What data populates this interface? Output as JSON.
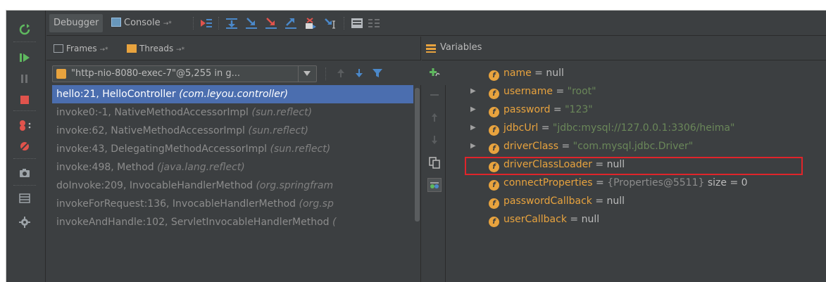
{
  "tabs": {
    "debugger": "Debugger",
    "console": "Console",
    "console_pin": "→*"
  },
  "panes": {
    "frames_tab": "Frames",
    "threads_tab": "Threads",
    "pin": "→*",
    "variables_title": "Variables"
  },
  "thread_selector": {
    "value": "\"http-nio-8080-exec-7\"@5,255 in g..."
  },
  "frames": [
    {
      "method": "hello:21, HelloController",
      "pkg": "(com.leyou.controller)"
    },
    {
      "method": "invoke0:-1, NativeMethodAccessorImpl",
      "pkg": "(sun.reflect)"
    },
    {
      "method": "invoke:62, NativeMethodAccessorImpl",
      "pkg": "(sun.reflect)"
    },
    {
      "method": "invoke:43, DelegatingMethodAccessorImpl",
      "pkg": "(sun.reflect)"
    },
    {
      "method": "invoke:498, Method",
      "pkg": "(java.lang.reflect)"
    },
    {
      "method": "doInvoke:209, InvocableHandlerMethod",
      "pkg": "(org.springfram"
    },
    {
      "method": "invokeForRequest:136, InvocableHandlerMethod",
      "pkg": "(org.sp"
    },
    {
      "method": "invokeAndHandle:102, ServletInvocableHandlerMethod",
      "pkg": "("
    }
  ],
  "variables": [
    {
      "name": "name",
      "eq": " = ",
      "value": "null",
      "value_kind": "null",
      "expandable": false
    },
    {
      "name": "username",
      "eq": " = ",
      "value": "\"root\"",
      "value_kind": "string",
      "expandable": true
    },
    {
      "name": "password",
      "eq": " = ",
      "value": "\"123\"",
      "value_kind": "string",
      "expandable": true
    },
    {
      "name": "jdbcUrl",
      "eq": " = ",
      "value": "\"jdbc:mysql://127.0.0.1:3306/heima\"",
      "value_kind": "string",
      "expandable": true,
      "highlighted": true
    },
    {
      "name": "driverClass",
      "eq": " = ",
      "value": "\"com.mysql.jdbc.Driver\"",
      "value_kind": "string",
      "expandable": true
    },
    {
      "name": "driverClassLoader",
      "eq": " = ",
      "value": "null",
      "value_kind": "null",
      "expandable": false
    },
    {
      "name": "connectProperties",
      "eq": " = ",
      "value": "{Properties@5511}",
      "extra": "  size = 0",
      "value_kind": "object",
      "expandable": false
    },
    {
      "name": "passwordCallback",
      "eq": " = ",
      "value": "null",
      "value_kind": "null",
      "expandable": false
    },
    {
      "name": "userCallback",
      "eq": " = ",
      "value": "null",
      "value_kind": "null",
      "expandable": false
    }
  ],
  "icons": {
    "field": "f"
  },
  "colors": {
    "background": "#3c3f41",
    "selection": "#4b6eaf",
    "field_name": "#e8a33e",
    "string_value": "#6a8759",
    "highlight_border": "#e0242a"
  }
}
